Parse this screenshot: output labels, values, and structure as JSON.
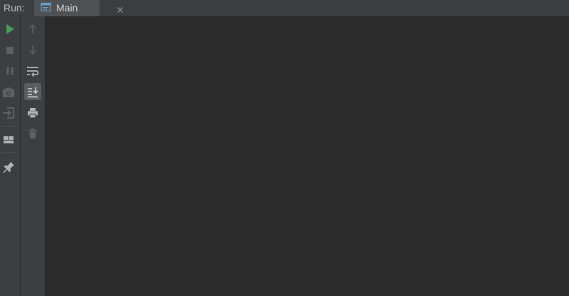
{
  "header": {
    "run_label": "Run:",
    "tab": {
      "label": "Main",
      "icon": "console-window-icon",
      "close_icon": "close-icon"
    }
  },
  "left_toolbar": {
    "items": [
      {
        "name": "rerun",
        "icon": "play-icon",
        "color": "#499c54"
      },
      {
        "name": "stop",
        "icon": "stop-icon",
        "enabled": false
      },
      {
        "name": "pause",
        "icon": "pause-icon",
        "enabled": false
      },
      {
        "name": "dump-threads",
        "icon": "camera-icon",
        "enabled": false
      },
      {
        "name": "exit",
        "icon": "exit-icon",
        "enabled": false
      },
      {
        "name": "restore-layout",
        "icon": "layout-icon"
      },
      {
        "name": "pin-tab",
        "icon": "pin-icon"
      }
    ]
  },
  "console_toolbar": {
    "items": [
      {
        "name": "up-stack-trace",
        "icon": "arrow-up-icon",
        "enabled": false
      },
      {
        "name": "down-stack-trace",
        "icon": "arrow-down-icon",
        "enabled": false
      },
      {
        "name": "soft-wrap",
        "icon": "soft-wrap-icon"
      },
      {
        "name": "scroll-to-end",
        "icon": "scroll-to-end-icon",
        "active": true
      },
      {
        "name": "print",
        "icon": "print-icon"
      },
      {
        "name": "clear-all",
        "icon": "trash-icon",
        "enabled": false
      }
    ]
  },
  "colors": {
    "background": "#2b2b2c",
    "toolbar": "#3c3f41",
    "run_green": "#499c54",
    "icon_enabled": "#afb1b3",
    "icon_disabled": "#5e6163"
  }
}
